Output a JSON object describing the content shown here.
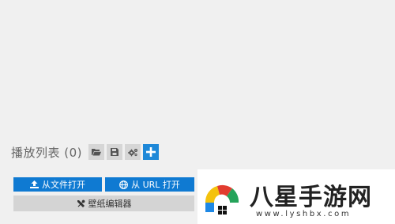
{
  "playlist": {
    "title": "播放列表 (0)",
    "tools": [
      {
        "icon": "folder-open-icon"
      },
      {
        "icon": "save-icon"
      },
      {
        "icon": "gears-icon"
      },
      {
        "icon": "plus-icon"
      }
    ]
  },
  "actions": {
    "open_file_label": "从文件打开",
    "open_url_label": "从 URL 打开",
    "editor_label": "壁纸编辑器"
  },
  "watermark": {
    "title": "八星手游网",
    "url": "www.lyshbx.com"
  },
  "colors": {
    "background": "#f0f0f0",
    "primary": "#0f7ad2",
    "secondary": "#d4d4d4",
    "add_button": "#1e88d8"
  }
}
